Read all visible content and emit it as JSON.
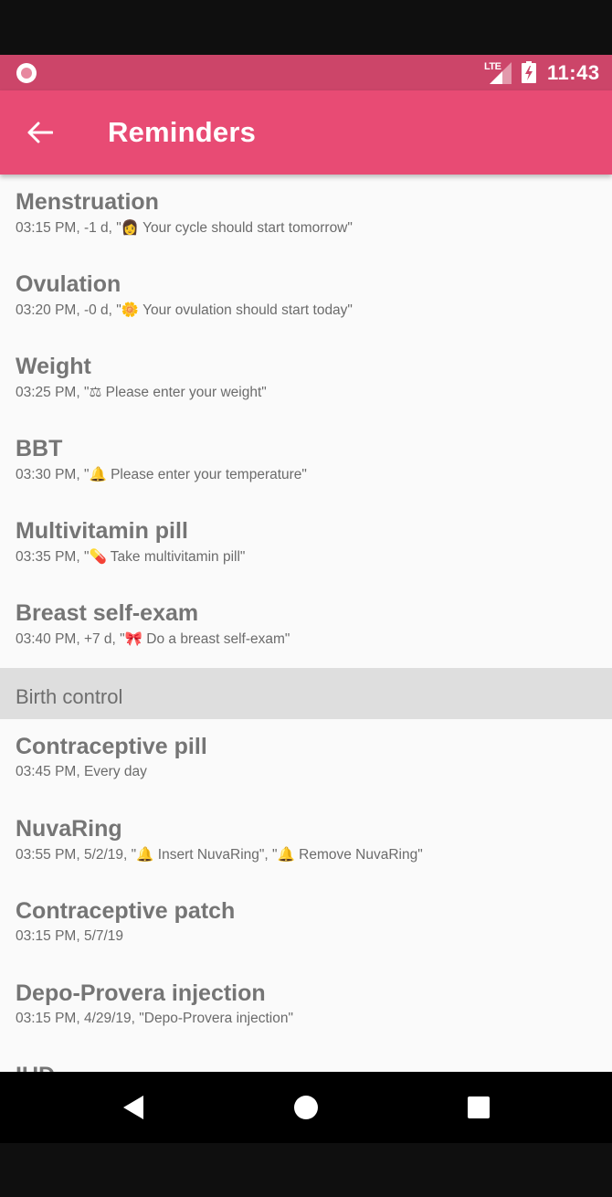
{
  "status_bar": {
    "network": "LTE",
    "time": "11:43"
  },
  "app_bar": {
    "title": "Reminders",
    "back_icon": "arrow-back-icon"
  },
  "reminders": [
    {
      "title": "Menstruation",
      "subtitle": "03:15 PM, -1 d, \"👩 Your cycle should start tomorrow\""
    },
    {
      "title": "Ovulation",
      "subtitle": "03:20 PM, -0 d, \"🌼 Your ovulation should start today\""
    },
    {
      "title": "Weight",
      "subtitle": "03:25 PM, \"⚖ Please enter your weight\""
    },
    {
      "title": "BBT",
      "subtitle": "03:30 PM, \"🔔 Please enter your temperature\""
    },
    {
      "title": "Multivitamin pill",
      "subtitle": "03:35 PM, \"💊 Take multivitamin pill\""
    },
    {
      "title": "Breast self-exam",
      "subtitle": "03:40 PM, +7 d, \"🎀 Do a breast self-exam\""
    }
  ],
  "birth_control": {
    "header": "Birth control",
    "items": [
      {
        "title": "Contraceptive pill",
        "subtitle": "03:45 PM, Every day"
      },
      {
        "title": "NuvaRing",
        "subtitle": "03:55 PM, 5/2/19, \"🔔 Insert NuvaRing\", \"🔔 Remove NuvaRing\""
      },
      {
        "title": "Contraceptive patch",
        "subtitle": "03:15 PM, 5/7/19"
      },
      {
        "title": "Depo-Provera injection",
        "subtitle": "03:15 PM, 4/29/19, \"Depo-Provera injection\""
      },
      {
        "title": "IUD",
        "subtitle": ""
      }
    ]
  },
  "nav_bar": {
    "back_icon": "nav-back-icon",
    "home_icon": "nav-home-icon",
    "recents_icon": "nav-recents-icon"
  },
  "colors": {
    "status_bar": "#cc4569",
    "app_bar": "#e84b74",
    "background": "#fafafa",
    "section_header": "#dedede",
    "title_text": "#757575"
  }
}
